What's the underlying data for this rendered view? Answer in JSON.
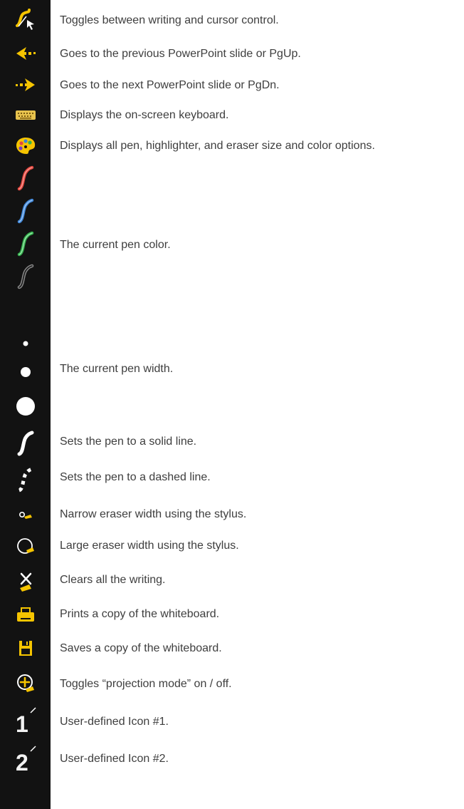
{
  "items": [
    {
      "icon": "writing-cursor-toggle-icon",
      "text": "Toggles between writing and cursor control."
    },
    {
      "icon": "previous-arrow-icon",
      "text": "Goes to the previous PowerPoint slide or PgUp."
    },
    {
      "icon": "next-arrow-icon",
      "text": "Goes to the next PowerPoint slide or PgDn."
    },
    {
      "icon": "keyboard-icon",
      "text": "Displays the on-screen keyboard."
    },
    {
      "icon": "palette-icon",
      "text": "Displays all pen, highlighter, and eraser size and color options."
    },
    {
      "icon": "pen-color-icon",
      "text": "The current pen color."
    },
    {
      "icon": "pen-width-icon",
      "text": "The current pen width."
    },
    {
      "icon": "solid-line-icon",
      "text": "Sets the pen to a solid line."
    },
    {
      "icon": "dashed-line-icon",
      "text": "Sets the pen to a dashed line."
    },
    {
      "icon": "narrow-eraser-icon",
      "text": "Narrow eraser width using the stylus."
    },
    {
      "icon": "large-eraser-icon",
      "text": "Large eraser width using the stylus."
    },
    {
      "icon": "clear-all-icon",
      "text": "Clears all the writing."
    },
    {
      "icon": "print-icon",
      "text": "Prints a copy of the whiteboard."
    },
    {
      "icon": "save-icon",
      "text": "Saves a copy of the whiteboard."
    },
    {
      "icon": "projection-mode-icon",
      "text": "Toggles “projection mode” on / off."
    },
    {
      "icon": "user-icon-1",
      "text": "User-defined Icon #1.",
      "label": "1"
    },
    {
      "icon": "user-icon-2",
      "text": "User-defined Icon #2.",
      "label": "2"
    }
  ],
  "colors": {
    "toolbar_bg": "#121212",
    "icon_yellow": "#f5c400",
    "pen_red": "#e5473f",
    "pen_blue": "#3f86d8",
    "pen_green": "#35b24e",
    "pen_gray": "#8a8a8a",
    "text": "#3e3e3e"
  }
}
